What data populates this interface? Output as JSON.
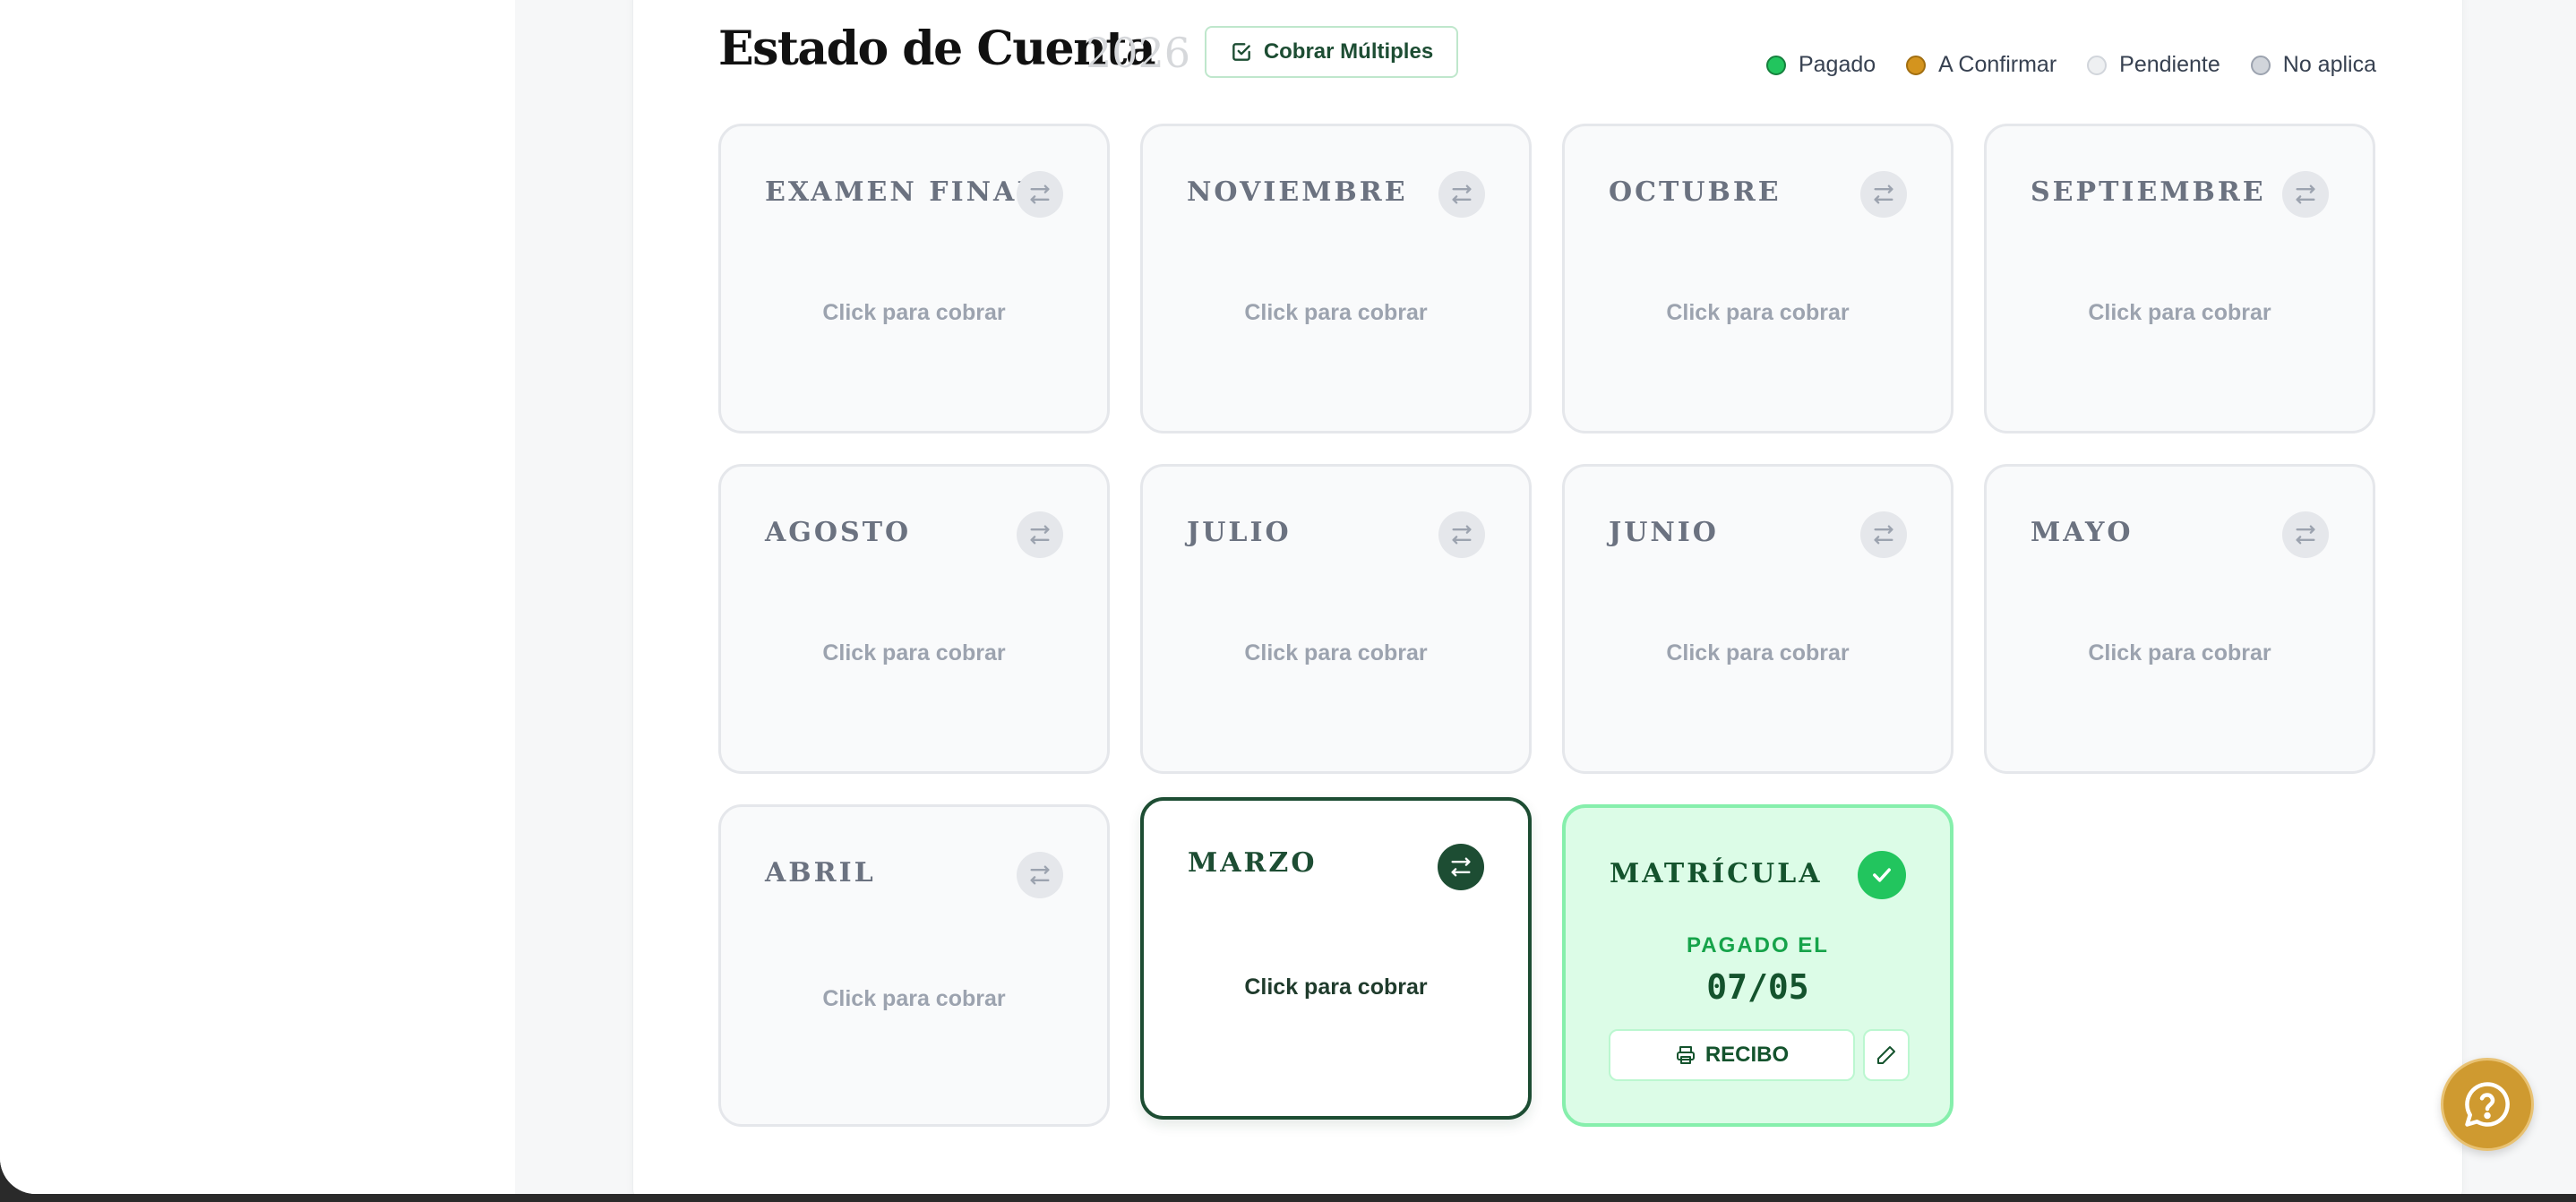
{
  "header": {
    "title": "Estado de Cuenta",
    "year": "2026",
    "multi_button": "Cobrar Múltiples"
  },
  "legend": [
    {
      "label": "Pagado",
      "color": "#22c55e"
    },
    {
      "label": "A Confirmar",
      "color": "#d4941e"
    },
    {
      "label": "Pendiente",
      "color": "#eef0f2"
    },
    {
      "label": "No aplica",
      "color": "#d1d5db"
    }
  ],
  "cards": [
    {
      "label": "EXAMEN FINAL",
      "cta": "Click para cobrar",
      "status": "pendiente"
    },
    {
      "label": "NOVIEMBRE",
      "cta": "Click para cobrar",
      "status": "pendiente"
    },
    {
      "label": "OCTUBRE",
      "cta": "Click para cobrar",
      "status": "pendiente"
    },
    {
      "label": "SEPTIEMBRE",
      "cta": "Click para cobrar",
      "status": "pendiente"
    },
    {
      "label": "AGOSTO",
      "cta": "Click para cobrar",
      "status": "pendiente"
    },
    {
      "label": "JULIO",
      "cta": "Click para cobrar",
      "status": "pendiente"
    },
    {
      "label": "JUNIO",
      "cta": "Click para cobrar",
      "status": "pendiente"
    },
    {
      "label": "MAYO",
      "cta": "Click para cobrar",
      "status": "pendiente"
    },
    {
      "label": "ABRIL",
      "cta": "Click para cobrar",
      "status": "pendiente"
    },
    {
      "label": "MARZO",
      "cta": "Click para cobrar",
      "status": "seleccionado"
    },
    {
      "label": "MATRÍCULA",
      "status": "pagado",
      "paid_label": "PAGADO EL",
      "paid_date": "07/05",
      "receipt_button": "RECIBO"
    }
  ],
  "icons": {
    "swap": "swap-arrows-icon",
    "check": "check-icon",
    "print": "printer-icon",
    "edit": "pencil-icon",
    "help": "help-chat-icon",
    "multi": "checkbox-square-icon"
  },
  "colors": {
    "brand_green": "#1d4d33",
    "paid_green": "#22c55e",
    "help_gold": "#cf9a30"
  }
}
